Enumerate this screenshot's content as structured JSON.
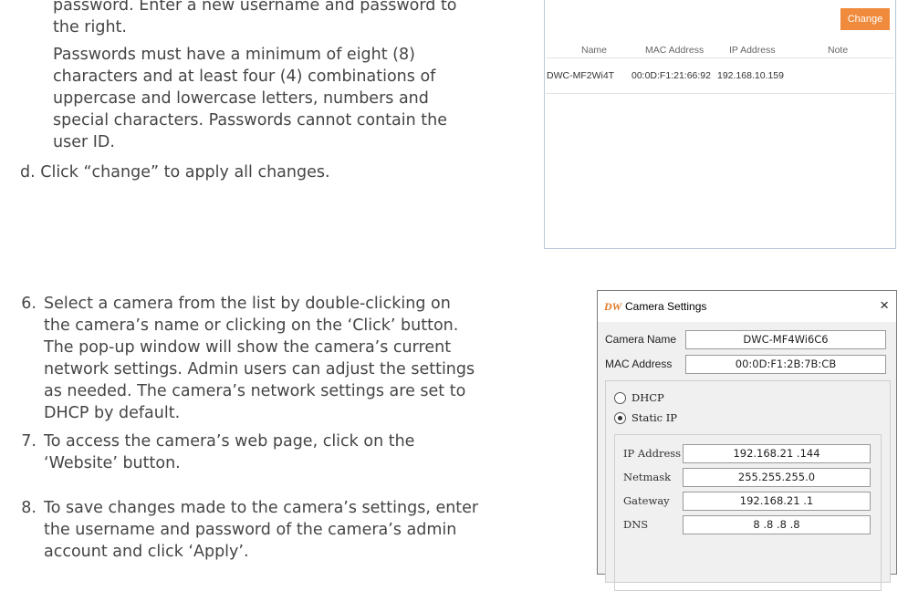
{
  "instructions": {
    "c_line1": "password. Enter a new username and password to",
    "c_line2": "the right.",
    "c_para2": [
      "Passwords must have a minimum of eight (8)",
      "characters and at least four (4) combinations of",
      "uppercase and lowercase letters, numbers and",
      "special characters. Passwords cannot contain the",
      "user ID."
    ],
    "d_item": "d. Click “change” to apply all changes.",
    "steps": [
      {
        "num": "6.",
        "lines": [
          "Select a camera from the list by double-clicking on",
          "the camera’s name or clicking on the ‘Click’ button.",
          "The pop-up window will show the camera’s current",
          "network settings. Admin users can adjust the settings",
          "as needed. The camera’s network settings are set to",
          "DHCP by default."
        ]
      },
      {
        "num": "7.",
        "lines": [
          "To access the camera’s web page, click on the",
          "‘Website’ button."
        ]
      },
      {
        "num": "8.",
        "lines": [
          "To save changes made to the camera’s settings, enter",
          "the username and password of the camera’s admin",
          "account and click ‘Apply’."
        ]
      }
    ]
  },
  "camera_list": {
    "change_label": "Change",
    "columns": [
      "Name",
      "MAC Address",
      "IP Address",
      "Note"
    ],
    "rows": [
      {
        "name": "DWC-MF2Wi4T",
        "mac": "00:0D:F1:21:66:92",
        "ip": "192.168.10.159",
        "note": ""
      }
    ]
  },
  "camera_settings": {
    "logo": "DW",
    "title": "Camera Settings",
    "close": "×",
    "camera_name_label": "Camera Name",
    "camera_name": "DWC-MF4Wi6C6",
    "mac_label": "MAC Address",
    "mac": "00:0D:F1:2B:7B:CB",
    "dhcp_label": "DHCP",
    "static_label": "Static IP",
    "mode": "static",
    "ip_label": "IP Address",
    "ip": "192.168.21 .144",
    "netmask_label": "Netmask",
    "netmask": "255.255.255.0",
    "gateway_label": "Gateway",
    "gateway": "192.168.21 .1",
    "dns_label": "DNS",
    "dns": "8 .8 .8 .8"
  },
  "colors": {
    "accent": "#f08a3c",
    "logo": "#e07a25"
  }
}
